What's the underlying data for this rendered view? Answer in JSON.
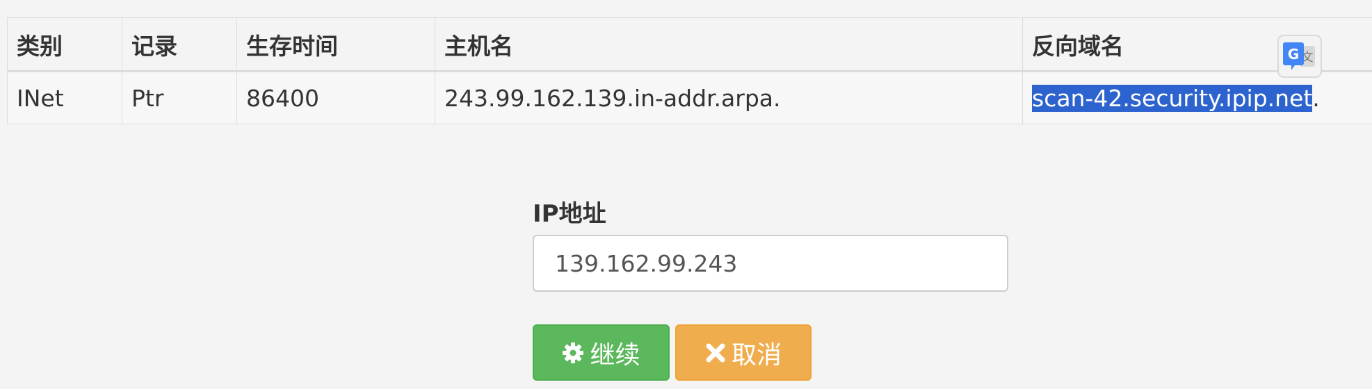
{
  "table": {
    "headers": [
      "类别",
      "记录",
      "生存时间",
      "主机名",
      "反向域名"
    ],
    "row": {
      "class": "INet",
      "record": "Ptr",
      "ttl": "86400",
      "hostname": "243.99.162.139.in-addr.arpa.",
      "reverse_selected": "scan-42.security.ipip.net",
      "reverse_suffix": "."
    }
  },
  "form": {
    "ip_label": "IP地址",
    "ip_value": "139.162.99.243"
  },
  "buttons": {
    "continue_label": "继续",
    "continue_icon": "gear-icon",
    "cancel_label": "取消",
    "cancel_icon": "close-icon"
  },
  "translate_widget": {
    "icon": "google-translate-icon"
  },
  "colors": {
    "background": "#f4f4f4",
    "selection": "#2d63cf",
    "continue_button": "#5cb85c",
    "cancel_button": "#f0ad4e"
  }
}
